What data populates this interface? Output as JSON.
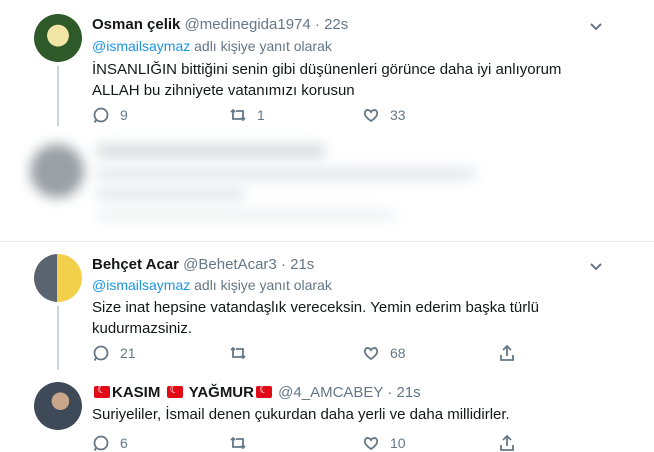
{
  "tweets": [
    {
      "name": "Osman çelik",
      "handle": "@medinegida1974",
      "dot": "·",
      "time": "22s",
      "reply_prefix": "@ismailsaymaz",
      "reply_suffix": " adlı kişiye yanıt olarak",
      "lines": [
        "İNSANLIĞIN bittiğini senin gibi düşünenleri görünce daha iyi anlıyorum",
        "ALLAH bu zihniyete vatanımızı korusun"
      ],
      "replies": "9",
      "retweets": "1",
      "likes": "33"
    },
    {
      "name": "Behçet Acar",
      "handle": "@BehetAcar3",
      "dot": "·",
      "time": "21s",
      "reply_prefix": "@ismailsaymaz",
      "reply_suffix": " adlı kişiye yanıt olarak",
      "lines": [
        "Size inat hepsine vatandaşlık vereceksin. Yemin ederim başka türlü",
        "kudurmazsiniz."
      ],
      "replies": "21",
      "retweets": "",
      "likes": "68"
    },
    {
      "name_a": "KASIM",
      "name_b": "YAĞMUR",
      "handle": "@4_AMCABEY",
      "dot": "·",
      "time": "21s",
      "lines": [
        "Suriyeliler, İsmail denen çukurdan daha yerli ve daha millidirler."
      ],
      "replies": "6",
      "retweets": "",
      "likes": "10"
    }
  ],
  "colors": {
    "link": "#1b95e0",
    "muted": "#657786",
    "flag": "#e30a17"
  }
}
